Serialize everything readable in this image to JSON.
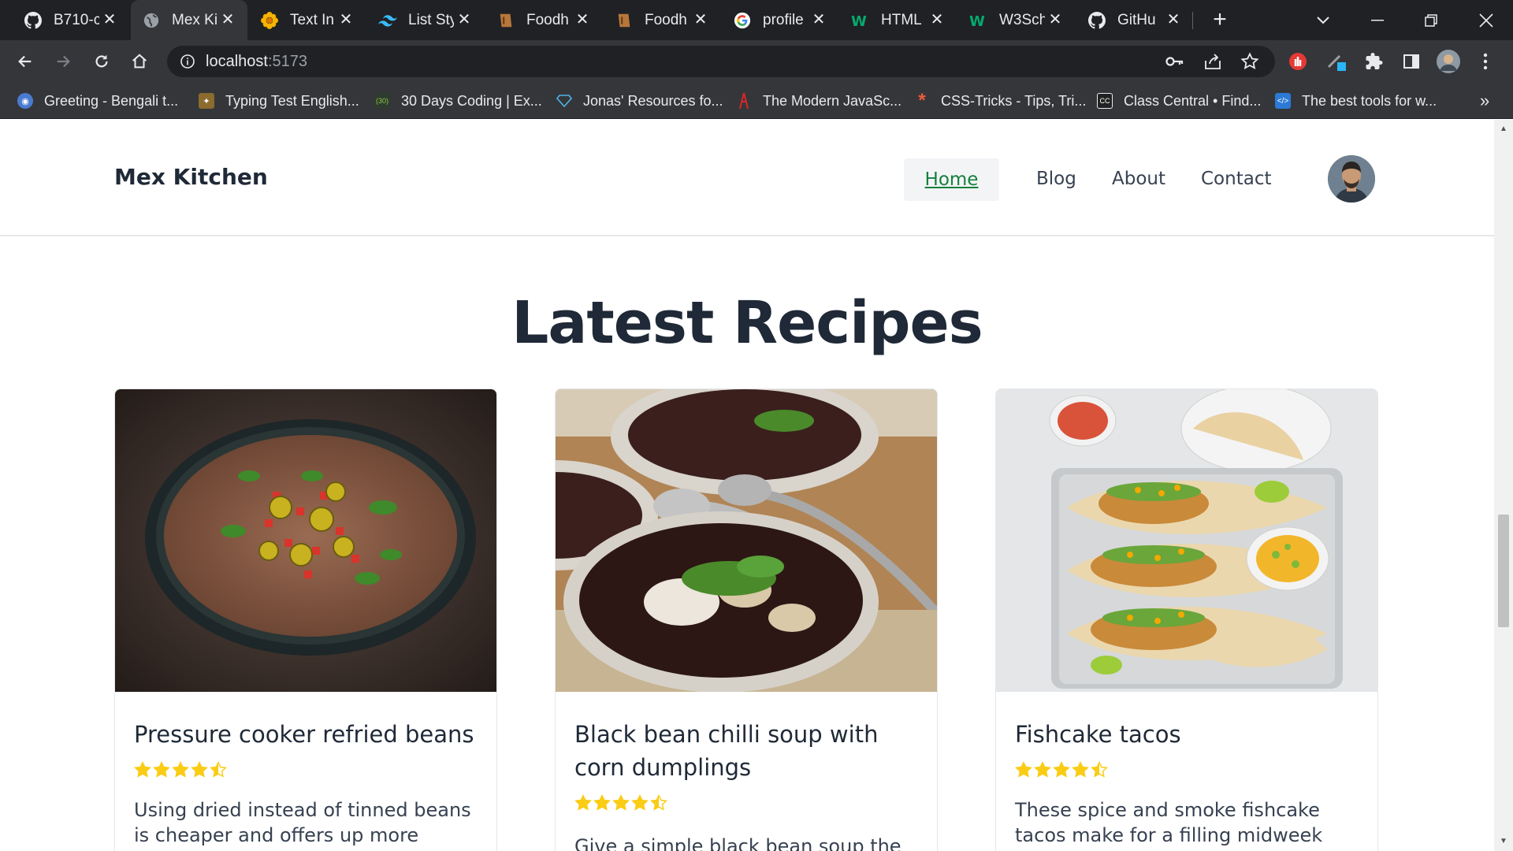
{
  "browser": {
    "tabs": [
      {
        "label": "B710-c",
        "icon": "github-icon",
        "active": false
      },
      {
        "label": "Mex Ki",
        "icon": "globe-icon",
        "active": true
      },
      {
        "label": "Text In",
        "icon": "flower-icon",
        "active": false
      },
      {
        "label": "List Sty",
        "icon": "tailwind-icon",
        "active": false
      },
      {
        "label": "Foodh",
        "icon": "foodhub-icon",
        "active": false
      },
      {
        "label": "Foodh",
        "icon": "foodhub-icon",
        "active": false
      },
      {
        "label": "profile",
        "icon": "google-icon",
        "active": false
      },
      {
        "label": "HTML",
        "icon": "w3schools-icon",
        "active": false
      },
      {
        "label": "W3Sch",
        "icon": "w3schools-icon",
        "active": false
      },
      {
        "label": "GitHu",
        "icon": "github-icon",
        "active": false
      }
    ],
    "url_host": "localhost",
    "url_port": ":5173",
    "bookmarks": [
      {
        "label": "Greeting - Bengali t...",
        "icon": "greeting-icon",
        "color": "#4a7bd0"
      },
      {
        "label": "Typing Test English...",
        "icon": "typing-icon",
        "color": "#8b6b2e"
      },
      {
        "label": "30 Days Coding | Ex...",
        "icon": "coding-icon",
        "color": "#2e3b2e"
      },
      {
        "label": "Jonas' Resources fo...",
        "icon": "diamond-icon",
        "color": "#4fb3e8"
      },
      {
        "label": "The Modern JavaSc...",
        "icon": "javascript-icon",
        "color": "#d62828"
      },
      {
        "label": "CSS-Tricks - Tips, Tri...",
        "icon": "asterisk-icon",
        "color": "#f15a3a"
      },
      {
        "label": "Class Central • Find...",
        "icon": "classcentral-icon",
        "color": "#222"
      },
      {
        "label": "The best tools for w...",
        "icon": "code-icon",
        "color": "#2c7ad6"
      }
    ],
    "more_bookmarks": "»"
  },
  "navbar": {
    "brand": "Mex Kitchen",
    "links": [
      "Home",
      "Blog",
      "About",
      "Contact"
    ],
    "active": "Home"
  },
  "section": {
    "title": "Latest Recipes"
  },
  "recipes": [
    {
      "title": "Pressure cooker refried beans",
      "rating": 4.5,
      "description": "Using dried instead of tinned beans is cheaper and offers up more flavour, but"
    },
    {
      "title": "Black bean chilli soup with corn dumplings",
      "rating": 4.5,
      "description": "Give a simple black bean soup the ultimate"
    },
    {
      "title": "Fishcake tacos",
      "rating": 4.5,
      "description": "These spice and smoke fishcake tacos make for a filling midweek dinner. Load"
    }
  ],
  "colors": {
    "accent_green": "#15803d",
    "star": "#facc15",
    "text_dark": "#1f2937"
  }
}
